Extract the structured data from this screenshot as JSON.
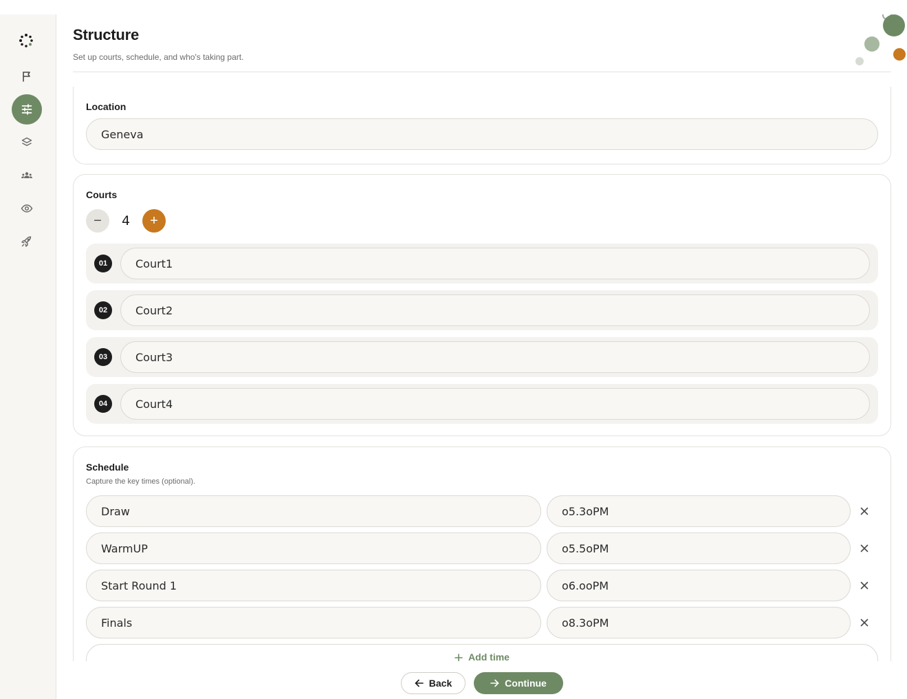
{
  "header": {
    "title": "Structure",
    "subtitle": "Set up courts, schedule, and who's taking part."
  },
  "sidebar": {
    "items": [
      {
        "icon": "flag-icon"
      },
      {
        "icon": "sliders-icon",
        "active": true
      },
      {
        "icon": "layers-icon"
      },
      {
        "icon": "users-icon"
      },
      {
        "icon": "eye-icon"
      },
      {
        "icon": "rocket-icon"
      }
    ]
  },
  "location": {
    "label": "Location",
    "value": "Geneva"
  },
  "courts": {
    "label": "Courts",
    "count": "4",
    "items": [
      {
        "num": "01",
        "name": "Court1"
      },
      {
        "num": "02",
        "name": "Court2"
      },
      {
        "num": "03",
        "name": "Court3"
      },
      {
        "num": "04",
        "name": "Court4"
      }
    ]
  },
  "schedule": {
    "label": "Schedule",
    "hint": "Capture the key times (optional).",
    "items": [
      {
        "name": "Draw",
        "time": "o5.3oPM"
      },
      {
        "name": "WarmUP",
        "time": "o5.5oPM"
      },
      {
        "name": "Start Round 1",
        "time": "o6.ooPM"
      },
      {
        "name": "Finals",
        "time": "o8.3oPM"
      }
    ],
    "add_label": "Add time"
  },
  "footer": {
    "back_label": "Back",
    "continue_label": "Continue"
  },
  "colors": {
    "accent_green": "#6e8a64",
    "accent_orange": "#c8781e",
    "dark": "#1d1d1d"
  }
}
